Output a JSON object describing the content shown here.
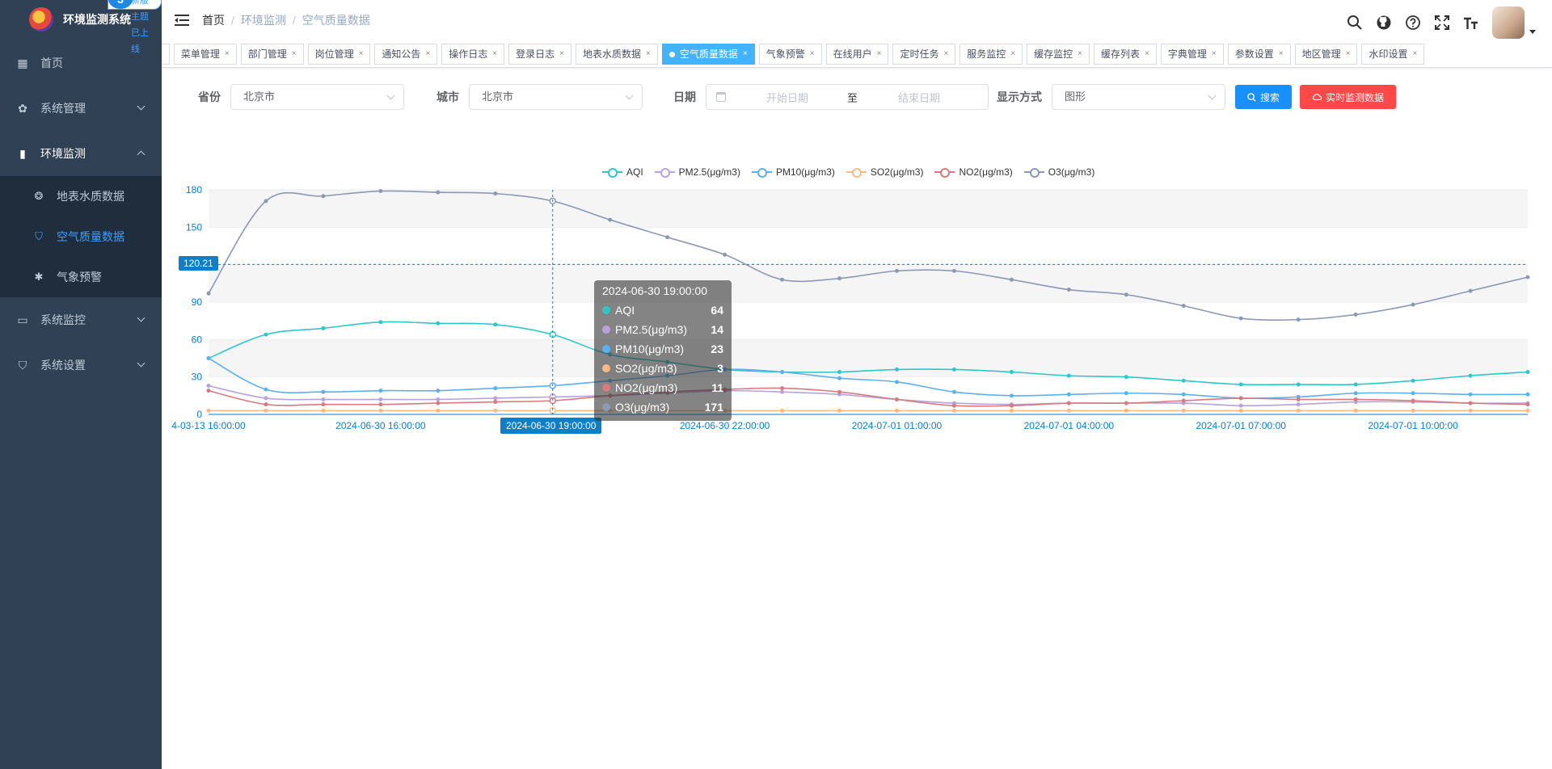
{
  "app": {
    "title": "环境监测系统",
    "promo": "新版主题已上线",
    "promo_num": "3"
  },
  "sidebar": {
    "items": [
      {
        "label": "首页",
        "icon": "dashboard-icon"
      },
      {
        "label": "系统管理",
        "icon": "gear-icon"
      },
      {
        "label": "环境监测",
        "icon": "bar-chart-icon"
      },
      {
        "label": "系统监控",
        "icon": "monitor-icon"
      },
      {
        "label": "系统设置",
        "icon": "shield-icon"
      }
    ],
    "subitems": [
      {
        "label": "地表水质数据",
        "icon": "water-icon"
      },
      {
        "label": "空气质量数据",
        "icon": "shield-check-icon"
      },
      {
        "label": "气象预警",
        "icon": "bug-icon"
      }
    ]
  },
  "breadcrumb": {
    "home": "首页",
    "section": "环境监测",
    "current": "空气质量数据"
  },
  "tags": [
    "菜单管理",
    "部门管理",
    "岗位管理",
    "通知公告",
    "操作日志",
    "登录日志",
    "地表水质数据",
    "空气质量数据",
    "气象预警",
    "在线用户",
    "定时任务",
    "服务监控",
    "缓存监控",
    "缓存列表",
    "字典管理",
    "参数设置",
    "地区管理",
    "水印设置"
  ],
  "active_tag": "空气质量数据",
  "filters": {
    "province_label": "省份",
    "province_value": "北京市",
    "city_label": "城市",
    "city_value": "北京市",
    "date_label": "日期",
    "start_placeholder": "开始日期",
    "range_sep": "至",
    "end_placeholder": "结束日期",
    "display_label": "显示方式",
    "display_value": "图形",
    "search_btn": "搜索",
    "realtime_btn": "实时监测数据"
  },
  "chart_data": {
    "type": "line",
    "series": [
      {
        "name": "AQI",
        "color": "#2ec7c9",
        "values": [
          45,
          64,
          69,
          74,
          73,
          72,
          64,
          48,
          42,
          36,
          34,
          34,
          36,
          36,
          34,
          31,
          30,
          27,
          24,
          24,
          24,
          27,
          31,
          34
        ]
      },
      {
        "name": "PM2.5(μg/m3)",
        "color": "#b6a2de",
        "values": [
          23,
          13,
          12,
          12,
          12,
          13,
          14,
          15,
          17,
          19,
          18,
          16,
          12,
          9,
          8,
          9,
          9,
          9,
          7,
          8,
          10,
          10,
          9,
          9
        ]
      },
      {
        "name": "PM10(μg/m3)",
        "color": "#5ab1ef",
        "values": [
          45,
          20,
          18,
          19,
          19,
          21,
          23,
          27,
          31,
          36,
          34,
          29,
          26,
          18,
          15,
          16,
          17,
          16,
          13,
          14,
          17,
          17,
          16,
          16
        ]
      },
      {
        "name": "SO2(μg/m3)",
        "color": "#ffb980",
        "values": [
          3,
          3,
          3,
          3,
          3,
          3,
          3,
          3,
          3,
          3,
          3,
          3,
          3,
          3,
          3,
          3,
          3,
          3,
          3,
          3,
          3,
          3,
          3,
          3
        ]
      },
      {
        "name": "NO2(μg/m3)",
        "color": "#d87a80",
        "values": [
          19,
          8,
          8,
          8,
          9,
          10,
          11,
          15,
          18,
          20,
          21,
          18,
          12,
          7,
          7,
          9,
          9,
          11,
          13,
          12,
          12,
          11,
          9,
          8
        ]
      },
      {
        "name": "O3(μg/m3)",
        "color": "#8d98b3",
        "values": [
          97,
          171,
          175,
          179,
          178,
          177,
          171,
          156,
          142,
          128,
          108,
          109,
          115,
          115,
          108,
          100,
          96,
          87,
          77,
          76,
          80,
          88,
          99,
          110
        ]
      }
    ],
    "x_tick_labels": [
      "4-03-13 16:00:00",
      "2024-06-30 16:00:00",
      "2024-06-30 19:00:00",
      "2024-06-30 22:00:00",
      "2024-07-01 01:00:00",
      "2024-07-01 04:00:00",
      "2024-07-01 07:00:00",
      "2024-07-01 10:00:00"
    ],
    "y_ticks": [
      0,
      30,
      60,
      90,
      120,
      150,
      180
    ],
    "ylim": [
      0,
      180
    ],
    "pointer": {
      "index": 6,
      "y_value": "120.21",
      "x_label": "2024-06-30 19:00:00"
    },
    "tooltip": {
      "title": "2024-06-30 19:00:00",
      "rows": [
        {
          "name": "AQI",
          "value": "64"
        },
        {
          "name": "PM2.5(μg/m3)",
          "value": "14"
        },
        {
          "name": "PM10(μg/m3)",
          "value": "23"
        },
        {
          "name": "SO2(μg/m3)",
          "value": "3"
        },
        {
          "name": "NO2(μg/m3)",
          "value": "11"
        },
        {
          "name": "O3(μg/m3)",
          "value": "171"
        }
      ]
    },
    "legend_position": "top-center",
    "grid": true
  }
}
